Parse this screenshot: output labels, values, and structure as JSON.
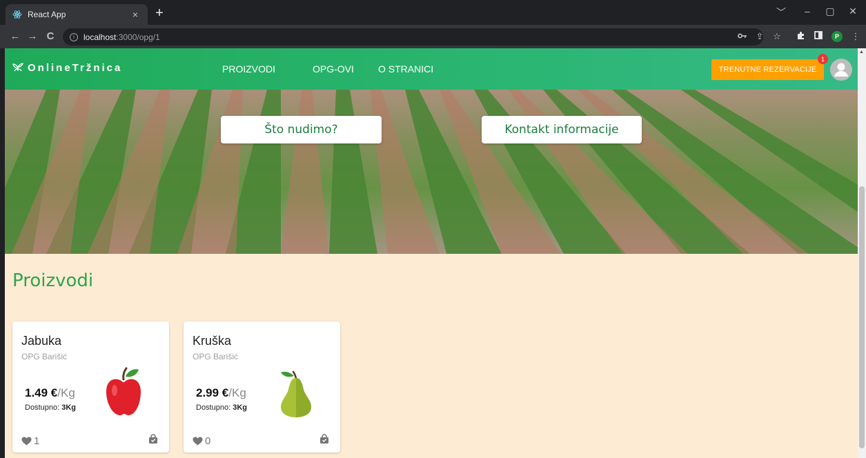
{
  "browser": {
    "tab_title": "React App",
    "tab_close": "×",
    "new_tab": "+",
    "url_host": "localhost",
    "url_path": ":3000/opg/1",
    "profile_initial": "P",
    "window_controls": {
      "dropdown": "﹀",
      "minimize": "–",
      "maximize": "▢",
      "close": "✕"
    },
    "nav": {
      "back": "←",
      "forward": "→",
      "reload": "C"
    }
  },
  "appbar": {
    "logo_text": "OnlineTržnica",
    "nav": [
      "PROIZVODI",
      "OPG-OVI",
      "O STRANICI"
    ],
    "reservations_label": "TRENUTNE REZERVACIJE",
    "reservations_count": "1",
    "colors": {
      "primary": "#2bb673",
      "accent": "#ffa000",
      "badge": "#e53935"
    }
  },
  "hero": {
    "buttons": [
      "Što nudimo?",
      "Kontakt informacije"
    ]
  },
  "section_title": "Proizvodi",
  "products": [
    {
      "name": "Jabuka",
      "farm": "OPG Barišić",
      "price": "1.49 €",
      "unit": "/Kg",
      "available_label": "Dostupno:",
      "available_value": "3Kg",
      "likes": "1",
      "image": "apple-icon"
    },
    {
      "name": "Kruška",
      "farm": "OPG Barišić",
      "price": "2.99 €",
      "unit": "/Kg",
      "available_label": "Dostupno:",
      "available_value": "3Kg",
      "likes": "0",
      "image": "pear-icon"
    }
  ]
}
